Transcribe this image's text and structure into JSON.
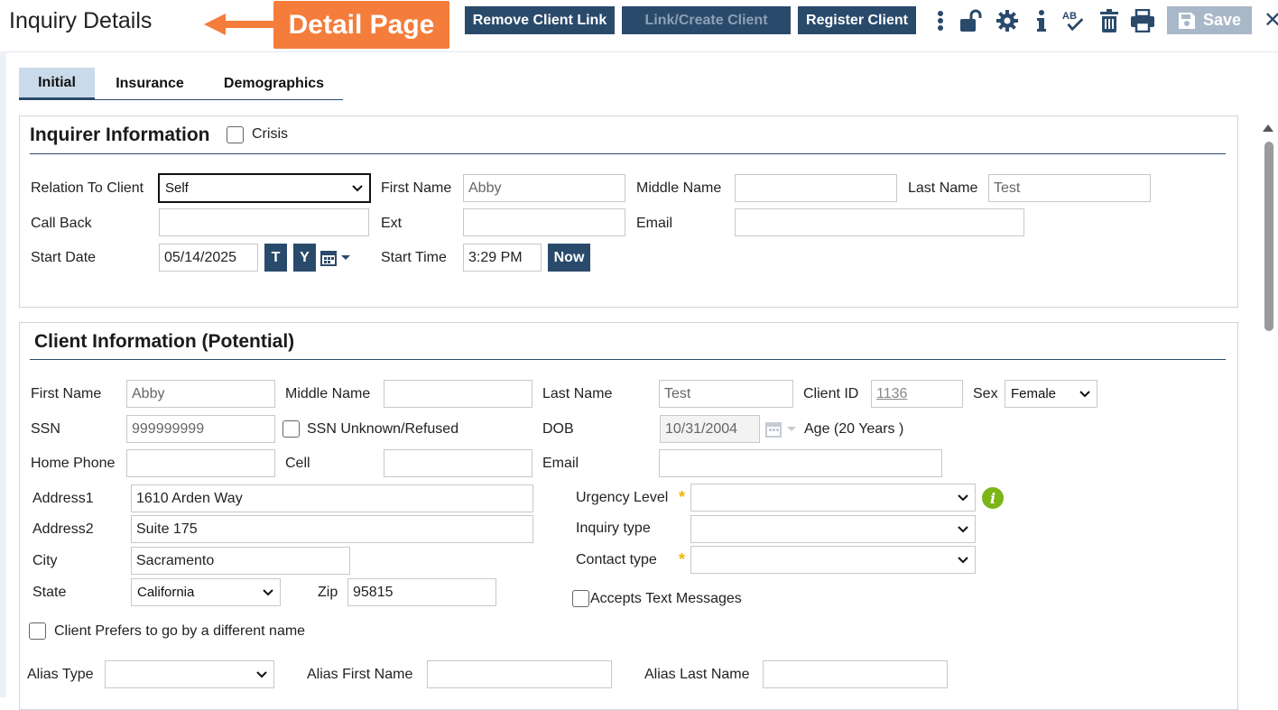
{
  "header": {
    "title": "Inquiry Details",
    "callout": "Detail Page",
    "buttons": {
      "remove_link": "Remove Client Link",
      "link_create": "Link/Create Client",
      "register": "Register Client",
      "save": "Save"
    },
    "icons": [
      "more-vertical-icon",
      "unlock-icon",
      "gear-icon",
      "info-icon",
      "spell-check-icon",
      "trash-icon",
      "print-icon",
      "save-disk-icon",
      "close-icon"
    ]
  },
  "tabs": [
    {
      "label": "Initial",
      "active": true
    },
    {
      "label": "Insurance",
      "active": false
    },
    {
      "label": "Demographics",
      "active": false
    }
  ],
  "inquirer": {
    "title": "Inquirer Information",
    "crisis_label": "Crisis",
    "relation_label": "Relation To Client",
    "relation_value": "Self",
    "first_name_label": "First Name",
    "first_name_value": "Abby",
    "middle_name_label": "Middle Name",
    "middle_name_value": "",
    "last_name_label": "Last Name",
    "last_name_value": "Test",
    "call_back_label": "Call Back",
    "ext_label": "Ext",
    "email_label": "Email",
    "start_date_label": "Start Date",
    "start_date_value": "05/14/2025",
    "t_btn": "T",
    "y_btn": "Y",
    "start_time_label": "Start Time",
    "start_time_value": "3:29 PM",
    "now_btn": "Now"
  },
  "client": {
    "title": "Client Information (Potential)",
    "first_name_label": "First Name",
    "first_name_value": "Abby",
    "middle_name_label": "Middle Name",
    "last_name_label": "Last Name",
    "last_name_value": "Test",
    "client_id_label": "Client ID",
    "client_id_value": "1136",
    "sex_label": "Sex",
    "sex_value": "Female",
    "ssn_label": "SSN",
    "ssn_value": "999999999",
    "ssn_unknown_label": "SSN Unknown/Refused",
    "dob_label": "DOB",
    "dob_value": "10/31/2004",
    "age_text": "Age (20 Years )",
    "home_phone_label": "Home Phone",
    "cell_label": "Cell",
    "email_label": "Email",
    "address1_label": "Address1",
    "address1_value": "1610 Arden Way",
    "address2_label": "Address2",
    "address2_value": "Suite 175",
    "city_label": "City",
    "city_value": "Sacramento",
    "state_label": "State",
    "state_value": "California",
    "zip_label": "Zip",
    "zip_value": "95815",
    "urgency_label": "Urgency Level",
    "inquiry_type_label": "Inquiry type",
    "contact_type_label": "Contact type",
    "accepts_text_label": "Accepts Text Messages",
    "prefers_name_label": "Client Prefers to go by a different name",
    "alias_type_label": "Alias Type",
    "alias_first_label": "Alias First Name",
    "alias_last_label": "Alias Last Name"
  },
  "colors": {
    "primary": "#2a4a6b",
    "callout": "#f47d3c",
    "tab_active": "#c9daea",
    "required_star": "#f0b400",
    "info_green": "#7cb518"
  }
}
